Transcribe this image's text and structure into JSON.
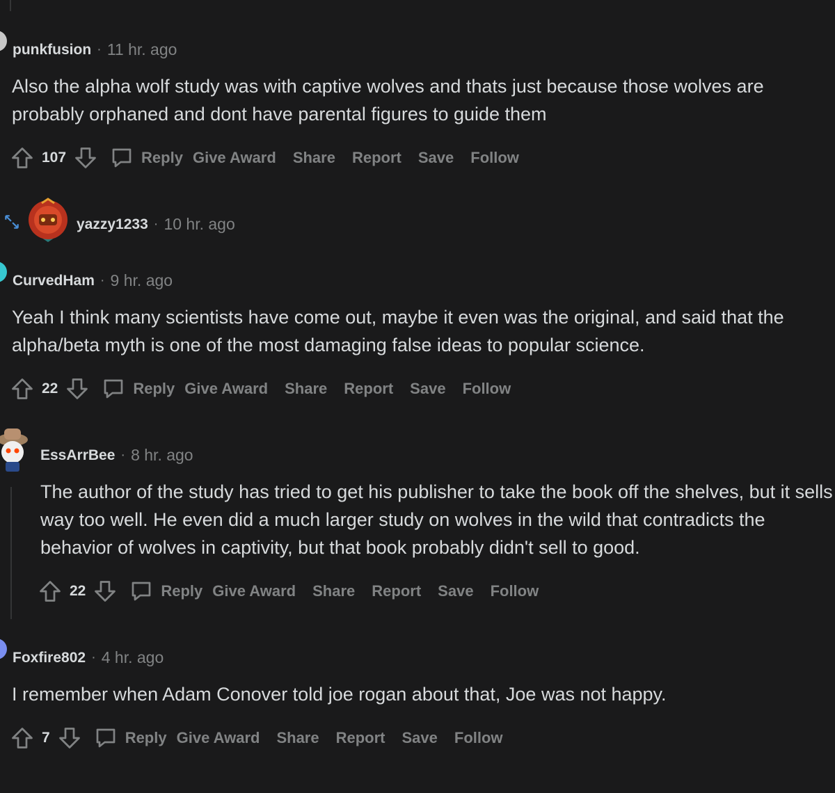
{
  "comments": [
    {
      "author": "punkfusion",
      "time": "11 hr. ago",
      "body": "Also the alpha wolf study was with captive wolves and thats just because those wolves are probably orphaned and dont have parental figures to guide them",
      "votes": "107"
    },
    {
      "author": "yazzy1233",
      "time": "10 hr. ago"
    },
    {
      "author": "CurvedHam",
      "time": "9 hr. ago",
      "body": "Yeah I think many scientists have come out, maybe it even was the original, and said that the alpha/beta myth is one of the most damaging false ideas to popular science.",
      "votes": "22"
    },
    {
      "author": "EssArrBee",
      "time": "8 hr. ago",
      "body": "The author of the study has tried to get his publisher to take the book off the shelves, but it sells way too well. He even did a much larger study on wolves in the wild that contradicts the behavior of wolves in captivity, but that book probably didn't sell to good.",
      "votes": "22"
    },
    {
      "author": "Foxfire802",
      "time": "4 hr. ago",
      "body": "I remember when Adam Conover told joe rogan about that, Joe was not happy.",
      "votes": "7"
    }
  ],
  "actions": {
    "reply": "Reply",
    "give_award": "Give Award",
    "share": "Share",
    "report": "Report",
    "save": "Save",
    "follow": "Follow"
  },
  "colors": {
    "background": "#1a1a1b",
    "text": "#d7dadc",
    "muted": "#818384",
    "thread_line": "#343536"
  }
}
